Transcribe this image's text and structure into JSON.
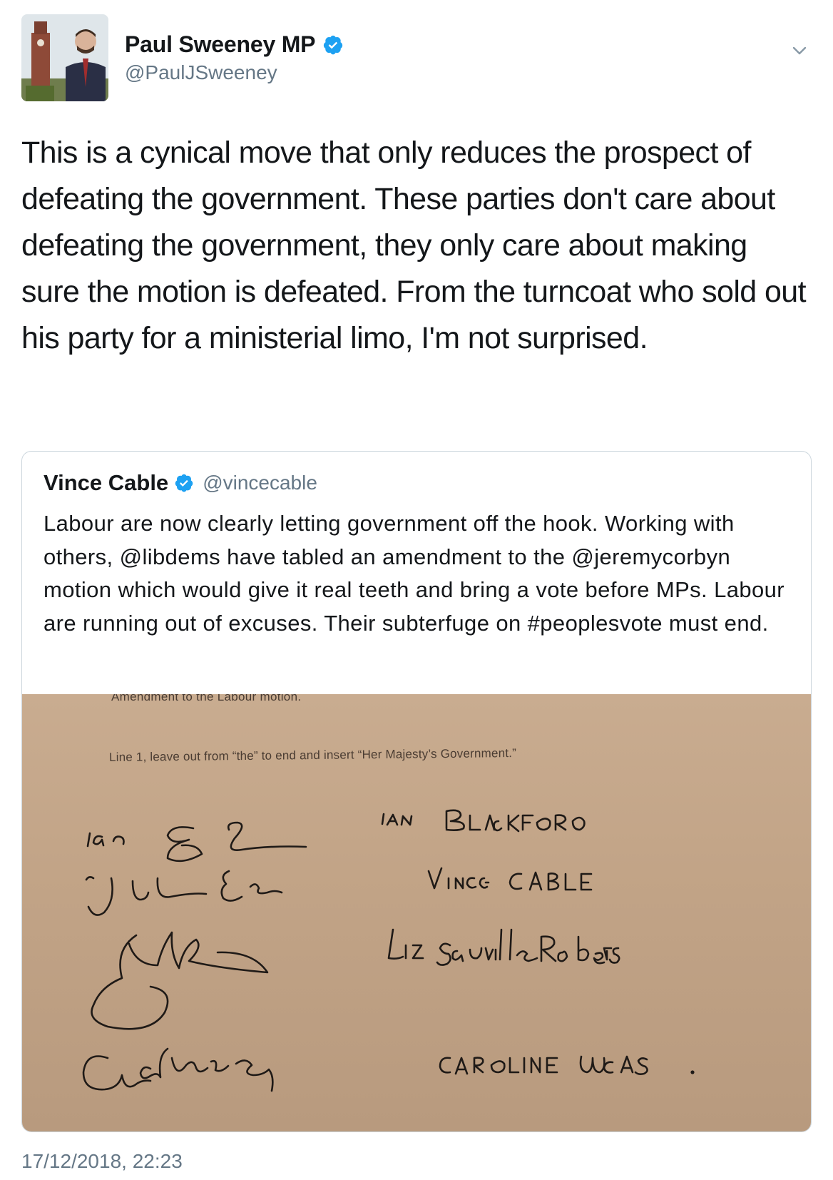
{
  "author": {
    "display_name": "Paul Sweeney MP",
    "handle": "@PaulJSweeney"
  },
  "tweet": {
    "text": "This is a cynical move that only reduces the prospect of defeating the government. These parties don't care about defeating the government, they only care about making sure the motion is defeated. From the turncoat who sold out his party for a ministerial limo, I'm not surprised.",
    "timestamp": "17/12/2018, 22:23"
  },
  "quoted_tweet": {
    "display_name": "Vince Cable",
    "handle": "@vincecable",
    "text": "Labour are now clearly letting government off the hook. Working with others, @libdems have tabled an amendment to the @jeremycorbyn motion which would give it real teeth and bring a vote before MPs. Labour are running out of excuses. Their subterfuge on #peoplesvote must end.",
    "image": {
      "heading": "Amendment to the Labour motion.",
      "line": "Line 1, leave out from “the” to end and insert “Her Majesty’s Government.”",
      "printed_names": [
        "IAN BLACKFORD",
        "VINCE CABLE",
        "Liz Saville Roberts",
        "CAROLINE LUCAS"
      ]
    }
  },
  "colors": {
    "primary_text": "#14171a",
    "secondary_text": "#657786",
    "verified_blue": "#1da1f2",
    "border": "#ccd6dd",
    "paper": "#c2a487"
  },
  "icons": {
    "verified": "verified-badge-icon",
    "chevron": "chevron-down-icon"
  }
}
